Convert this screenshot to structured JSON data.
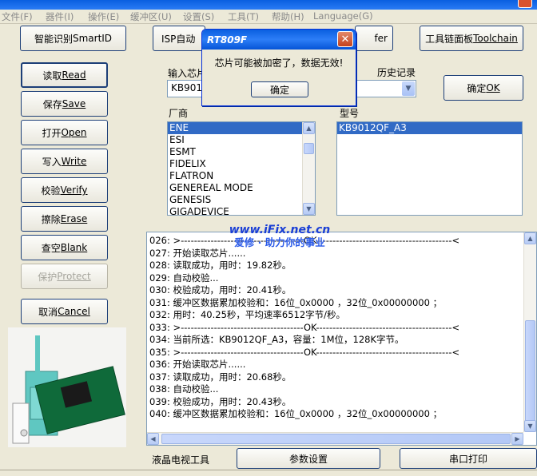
{
  "menu": [
    "文件(F)",
    "器件(I)",
    "操作(E)",
    "缓冲区(U)",
    "设置(S)",
    "工具(T)",
    "帮助(H)",
    "Language(G)"
  ],
  "buttons": {
    "smartid": {
      "zh": "智能识别 ",
      "en": "SmartID"
    },
    "isp": {
      "zh": "ISP自动",
      "en": ""
    },
    "transfer": {
      "zh": "",
      "en": "fer"
    },
    "toolchain": {
      "zh": "工具链面板 ",
      "en": "Toolchain"
    },
    "read": {
      "zh": "读取 ",
      "en": "Read"
    },
    "save": {
      "zh": "保存 ",
      "en": "Save"
    },
    "open": {
      "zh": "打开 ",
      "en": "Open"
    },
    "write": {
      "zh": "写入 ",
      "en": "Write"
    },
    "verify": {
      "zh": "校验 ",
      "en": "Verify"
    },
    "erase": {
      "zh": "擦除 ",
      "en": "Erase"
    },
    "blank": {
      "zh": "查空 ",
      "en": "Blank"
    },
    "protect": {
      "zh": "保护 ",
      "en": "Protect"
    },
    "cancel": {
      "zh": "取消 ",
      "en": "Cancel"
    },
    "ok": {
      "zh": "确定 ",
      "en": "OK"
    },
    "lcd_tool": "液晶电视工具",
    "params": "参数设置",
    "serial_print": "串口打印"
  },
  "chip_input": {
    "label": "输入芯片",
    "value": "KB9012"
  },
  "history": {
    "label": "历史记录",
    "value": ""
  },
  "vendor": {
    "label": "厂商",
    "items": [
      "ENE",
      "ESI",
      "ESMT",
      "FIDELIX",
      "FLATRON",
      "GENEREAL MODE",
      "GENESIS",
      "GIGADEVICE"
    ],
    "selected": "ENE"
  },
  "model": {
    "label": "型号",
    "items": [
      "KB9012QF_A3"
    ],
    "selected": "KB9012QF_A3"
  },
  "log": [
    "026: >-------------------------------------OK-----------------------------------------<",
    "027: 开始读取芯片......",
    "028: 读取成功，用时：19.82秒。",
    "029: 自动校验...",
    "030: 校验成功，用时：20.41秒。",
    "031: 缓冲区数据累加校验和：16位_0x0000 ，32位_0x00000000 ；",
    "032: 用时：40.25秒，平均速率6512字节/秒。",
    "033: >-------------------------------------OK-----------------------------------------<",
    "034: 当前所选：KB9012QF_A3，容量：1M位，128K字节。",
    "035: >-------------------------------------OK-----------------------------------------<",
    "036: 开始读取芯片......",
    "037: 读取成功，用时：20.68秒。",
    "038: 自动校验...",
    "039: 校验成功，用时：20.43秒。",
    "040: 缓冲区数据累加校验和：16位_0x0000 ，32位_0x00000000 ；"
  ],
  "watermark": {
    "site": "www.iFix.net.cn",
    "slogan": "爱修 · 助力你的事业"
  },
  "dialog": {
    "title": "RT809F",
    "message": "芯片可能被加密了，数据无效!",
    "ok_label": "确定",
    "close_glyph": "✕"
  },
  "icons": {
    "dropdown": "chevron-down-icon",
    "scroll_up": "arrow-up-icon",
    "scroll_down": "arrow-down-icon"
  }
}
